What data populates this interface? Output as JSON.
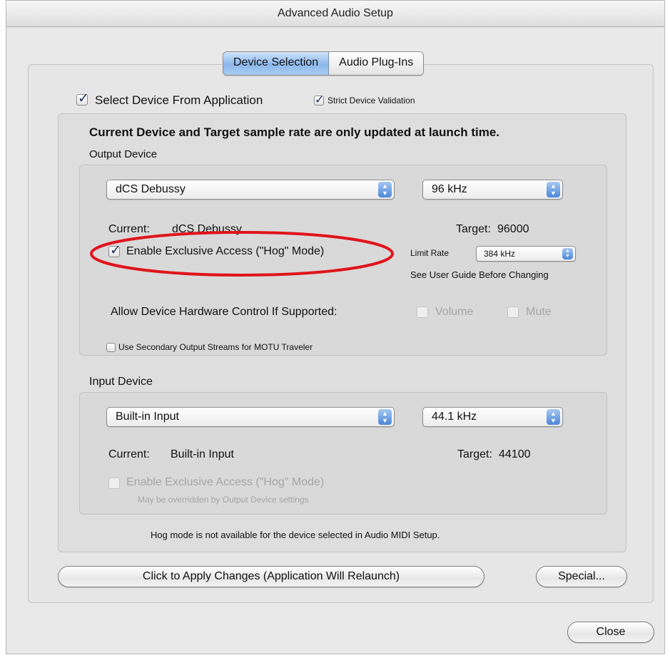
{
  "window": {
    "title": "Advanced Audio Setup"
  },
  "tabs": [
    {
      "label": "Device Selection",
      "active": true
    },
    {
      "label": "Audio Plug-Ins",
      "active": false
    }
  ],
  "options": {
    "select_device_from_app": {
      "label": "Select Device From Application",
      "checked": true
    },
    "strict_device_validation": {
      "label": "Strict Device Validation",
      "checked": true
    }
  },
  "notice": "Current Device and Target sample rate are only updated at launch time.",
  "output": {
    "section_label": "Output Device",
    "device": "dCS Debussy",
    "rate": "96 kHz",
    "current_label": "Current:",
    "current_value": "dCS Debussy",
    "target_label": "Target:",
    "target_value": "96000",
    "hog_label": "Enable Exclusive Access (\"Hog\" Mode)",
    "hog_checked": true,
    "limit_rate_label": "Limit Rate",
    "limit_rate_value": "384 kHz",
    "guide_note": "See User Guide Before Changing",
    "hardware_control_label": "Allow Device Hardware Control If Supported:",
    "volume_label": "Volume",
    "mute_label": "Mute",
    "secondary_streams_label": "Use Secondary Output Streams for MOTU Traveler",
    "secondary_streams_checked": false
  },
  "input": {
    "section_label": "Input Device",
    "device": "Built-in Input",
    "rate": "44.1 kHz",
    "current_label": "Current:",
    "current_value": "Built-in Input",
    "target_label": "Target:",
    "target_value": "44100",
    "hog_label": "Enable Exclusive Access (\"Hog\" Mode)",
    "hog_note": "May be overridden by Output Device settings"
  },
  "footer_note": "Hog mode is not available for the device selected in Audio MIDI Setup.",
  "buttons": {
    "apply": "Click to Apply Changes (Application Will Relaunch)",
    "special": "Special...",
    "close": "Close"
  },
  "colors": {
    "highlight_ellipse": "#e0141b",
    "selected_tab": "#8db8ec",
    "popup_arrow": "#4b86d7"
  }
}
